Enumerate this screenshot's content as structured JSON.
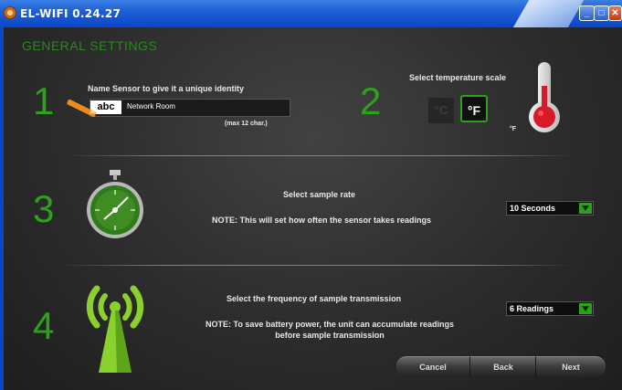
{
  "window": {
    "title": "EL-WIFI 0.24.27"
  },
  "section_title": "GENERAL SETTINGS",
  "step1": {
    "number": "1",
    "label": "Name Sensor to give it a unique identity",
    "input_tag": "abc",
    "input_value": "Network Room",
    "hint": "(max 12 char.)"
  },
  "step2": {
    "number": "2",
    "label": "Select temperature scale",
    "celsius": "°C",
    "fahrenheit": "°F",
    "selected_unit": "°F"
  },
  "step3": {
    "number": "3",
    "label": "Select sample rate",
    "note": "NOTE: This will set how often the sensor takes readings",
    "rate_value": "10 Seconds"
  },
  "step4": {
    "number": "4",
    "label": "Select the frequency of sample transmission",
    "note_line1": "NOTE: To save battery power, the unit can accumulate readings",
    "note_line2": "before sample transmission",
    "freq_value": "6 Readings"
  },
  "buttons": {
    "cancel": "Cancel",
    "back": "Back",
    "next": "Next"
  },
  "colors": {
    "accent_green": "#2ea11c",
    "title_blue": "#1f5fd4",
    "thermo_red": "#d8192a"
  }
}
